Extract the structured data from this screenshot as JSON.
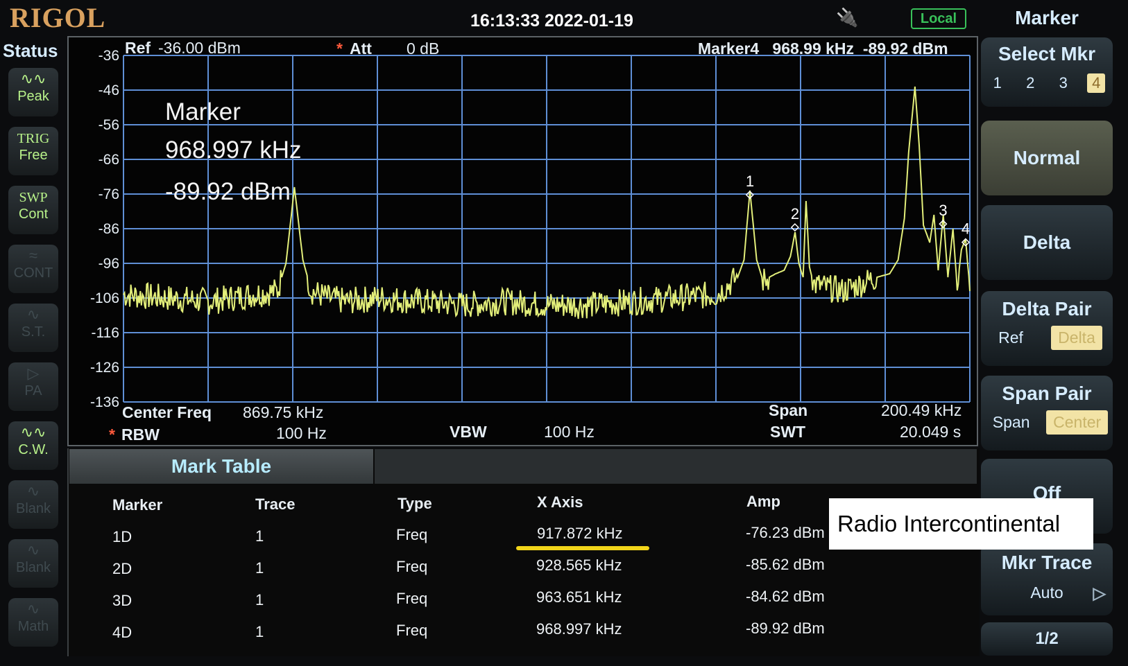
{
  "header": {
    "brand": "RIGOL",
    "datetime": "16:13:33 2022-01-19",
    "remote_status": "Local",
    "usb_icon": "usb-plug-icon"
  },
  "status_panel": {
    "title": "Status",
    "buttons": [
      {
        "icon": "peak-icon",
        "label": "Peak",
        "active": true
      },
      {
        "label_top": "TRIG",
        "label": "Free",
        "active": true
      },
      {
        "label_top": "SWP",
        "label": "Cont",
        "active": true
      },
      {
        "icon": "cont-icon",
        "label": "CONT",
        "active": false
      },
      {
        "icon": "st-icon",
        "label": "S.T.",
        "active": false
      },
      {
        "icon": "pa-icon",
        "label": "PA",
        "active": false
      },
      {
        "icon": "cw-icon",
        "label": "C.W.",
        "active": true
      },
      {
        "icon": "blank-icon",
        "label": "Blank",
        "active": false
      },
      {
        "icon": "blank-icon",
        "label": "Blank",
        "active": false
      },
      {
        "icon": "math-icon",
        "label": "Math",
        "active": false
      }
    ]
  },
  "screen": {
    "ref_label": "Ref",
    "ref_value": "-36.00 dBm",
    "att_label": "Att",
    "att_value": "0 dB",
    "marker_readout": "Marker4   968.99 kHz  -89.92 dBm",
    "big_marker": {
      "title": "Marker",
      "freq": "968.997 kHz",
      "amp": "-89.92 dBm"
    },
    "center_label": "Center Freq",
    "center_value": "869.75 kHz",
    "span_label": "Span",
    "span_value": "200.49 kHz",
    "rbw_label": "RBW",
    "rbw_value": "100 Hz",
    "vbw_label": "VBW",
    "vbw_value": "100 Hz",
    "swt_label": "SWT",
    "swt_value": "20.049 s",
    "trace_color": "#e3ef7a",
    "grid_color": "#5f8fd6"
  },
  "chart_data": {
    "type": "line",
    "x_unit": "kHz",
    "y_unit": "dBm",
    "xlim": [
      769.505,
      969.995
    ],
    "ylim": [
      -136,
      -36
    ],
    "y_ticks": [
      -36,
      -46,
      -56,
      -66,
      -76,
      -86,
      -96,
      -106,
      -116,
      -126,
      -136
    ],
    "grid": true,
    "series": [
      {
        "x": [
          769.5,
          780,
          790,
          800,
          806,
          808,
          810,
          812,
          814,
          818,
          822,
          830,
          840,
          850,
          860,
          870,
          880,
          890,
          900,
          910,
          912,
          915,
          916.5,
          917.9,
          919.5,
          921,
          924,
          926,
          927.5,
          928.6,
          929.5,
          930.5,
          931.2,
          932,
          933,
          936,
          940,
          944,
          948,
          951,
          953,
          954.5,
          955.5,
          957,
          958,
          959,
          960.5,
          961.5,
          962.5,
          963.7,
          964.8,
          966,
          967,
          968.0,
          969.0,
          970.0
        ],
        "y": [
          -105,
          -106,
          -107,
          -105,
          -104,
          -96,
          -74,
          -95,
          -104,
          -106,
          -107,
          -106,
          -107,
          -108,
          -107,
          -108,
          -108,
          -107,
          -106,
          -105,
          -103,
          -100,
          -95,
          -75,
          -95,
          -101,
          -99,
          -98,
          -94,
          -87,
          -96,
          -100,
          -78,
          -97,
          -102,
          -103,
          -104,
          -102,
          -100,
          -99,
          -95,
          -83,
          -64,
          -45,
          -62,
          -85,
          -90,
          -82,
          -98,
          -82,
          -100,
          -86,
          -103,
          -92,
          -89,
          -104
        ]
      }
    ],
    "markers": [
      {
        "id": "1",
        "x": 917.872,
        "y": -76.23
      },
      {
        "id": "2",
        "x": 928.565,
        "y": -85.62
      },
      {
        "id": "3",
        "x": 963.651,
        "y": -84.62
      },
      {
        "id": "4",
        "x": 968.997,
        "y": -89.92
      }
    ]
  },
  "mark_table": {
    "tab": "Mark Table",
    "headers": [
      "Marker",
      "Trace",
      "Type",
      "X Axis",
      "Amp"
    ],
    "rows": [
      [
        "1D",
        "1",
        "Freq",
        "917.872 kHz",
        "-76.23 dBm"
      ],
      [
        "2D",
        "1",
        "Freq",
        "928.565 kHz",
        "-85.62 dBm"
      ],
      [
        "3D",
        "1",
        "Freq",
        "963.651 kHz",
        "-84.62 dBm"
      ],
      [
        "4D",
        "1",
        "Freq",
        "968.997 kHz",
        "-89.92 dBm"
      ]
    ],
    "highlight_color": "#f2d51a"
  },
  "annotation": "Radio Intercontinental",
  "softkeys": {
    "menu_title": "Marker",
    "select_mkr": "Select Mkr",
    "mkr_numbers": [
      "1",
      "2",
      "3",
      "4"
    ],
    "normal": "Normal",
    "delta": "Delta",
    "delta_pair": "Delta Pair",
    "delta_pair_ref": "Ref",
    "delta_pair_delta": "Delta",
    "span_pair": "Span Pair",
    "span_pair_span": "Span",
    "span_pair_center": "Center",
    "off": "Off",
    "mkr_trace": "Mkr Trace",
    "mkr_trace_value": "Auto",
    "page": "1/2"
  }
}
